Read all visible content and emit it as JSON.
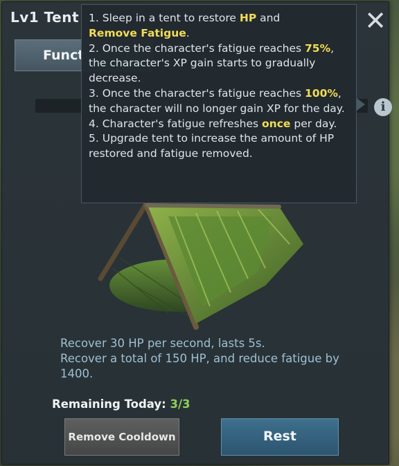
{
  "header": {
    "title": "Lv1 Tent",
    "close_symbol": "✕"
  },
  "tabs": [
    {
      "label": "Funct"
    }
  ],
  "info_icon": {
    "symbol": "i"
  },
  "tooltip": {
    "items": [
      {
        "num": "1.",
        "parts": [
          "Sleep in a tent to restore ",
          "HP",
          " and ",
          "Remove Fatigue",
          "."
        ]
      },
      {
        "num": "2.",
        "parts": [
          "Once the character's fatigue reaches ",
          "75%",
          ", the character's XP gain starts to gradually decrease."
        ]
      },
      {
        "num": "3.",
        "parts": [
          "Once the character's fatigue reaches ",
          "100%",
          ", the character will no longer gain XP for the day."
        ]
      },
      {
        "num": "4.",
        "parts": [
          "Character's fatigue refreshes ",
          "once",
          " per day."
        ]
      },
      {
        "num": "5.",
        "text": "Upgrade tent to increase the amount of HP restored and fatigue removed."
      }
    ]
  },
  "description": {
    "line1": "Recover 30 HP per second, lasts 5s.",
    "line2": "Recover a total of 150 HP, and reduce fatigue by 1400."
  },
  "remaining": {
    "label": "Remaining Today:",
    "value": "3/3"
  },
  "buttons": {
    "cooldown_label": "Remove Cooldown",
    "rest_label": "Rest"
  },
  "colors": {
    "highlight": "#f2dc55",
    "description_text": "#9fc0d4",
    "remaining_value": "#8fd15a",
    "rest_button": "#3e6f8c",
    "cooldown_button": "#5e5f5f"
  }
}
